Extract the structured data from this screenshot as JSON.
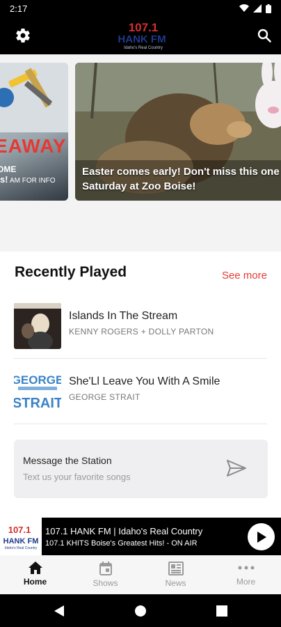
{
  "status_bar": {
    "time": "2:17"
  },
  "header": {
    "logo_number": "107.1",
    "logo_name": "HANK FM",
    "logo_tagline": "Idaho's Real Country"
  },
  "carousel": {
    "cards": [
      {
        "title_big": "EAWAY",
        "sub1": "OME",
        "sub2": "ns!",
        "sub3": "AM FOR INFO"
      },
      {
        "title": "Easter comes early! Don't miss this one Saturday at Zoo Boise!"
      }
    ]
  },
  "recently_played": {
    "title": "Recently Played",
    "see_more": "See more",
    "tracks": [
      {
        "title": "Islands In The Stream",
        "artist": "KENNY ROGERS + DOLLY PARTON"
      },
      {
        "title": "She'Ll Leave You With A Smile",
        "artist": "GEORGE STRAIT",
        "art_text_1": "GEORGE",
        "art_text_2": "STRAIT"
      }
    ]
  },
  "message": {
    "title": "Message the Station",
    "placeholder": "Text us your favorite songs"
  },
  "player": {
    "station": "107.1 HANK FM | Idaho's Real Country",
    "now_playing": "107.1 KHITS Boise's Greatest Hits! - ON AIR"
  },
  "bottom_nav": {
    "items": [
      {
        "label": "Home",
        "icon": "home-icon",
        "active": true
      },
      {
        "label": "Shows",
        "icon": "calendar-icon",
        "active": false
      },
      {
        "label": "News",
        "icon": "news-icon",
        "active": false
      },
      {
        "label": "More",
        "icon": "more-icon",
        "active": false
      }
    ]
  },
  "colors": {
    "accent": "#e53935",
    "brand_blue": "#1e3a8a",
    "player_bg": "#000000"
  }
}
